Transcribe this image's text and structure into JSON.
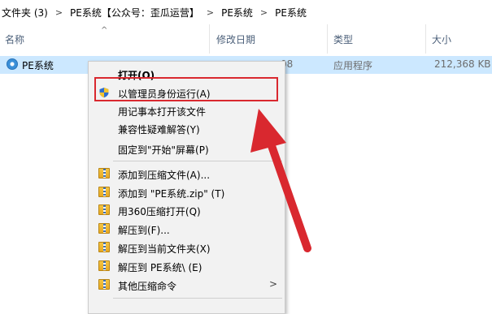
{
  "breadcrumb": {
    "items": [
      "文件夹 (3)",
      "PE系统【公众号：歪瓜运营】",
      "PE系统",
      "PE系统"
    ]
  },
  "columns": {
    "name": "名称",
    "date": "修改日期",
    "type": "类型",
    "size": "大小"
  },
  "file": {
    "name": "PE系统",
    "date_partial": ":08",
    "type": "应用程序",
    "size": "212,368 KB"
  },
  "context_menu": {
    "items": [
      {
        "label": "打开(O)",
        "icon": "none",
        "bold": true
      },
      {
        "label": "以管理员身份运行(A)",
        "icon": "uac-shield-icon"
      },
      {
        "label": "用记事本打开该文件",
        "icon": "none"
      },
      {
        "label": "兼容性疑难解答(Y)",
        "icon": "none"
      },
      {
        "label": "固定到\"开始\"屏幕(P)",
        "icon": "none"
      },
      {
        "label": "添加到压缩文件(A)...",
        "icon": "zip-icon"
      },
      {
        "label": "添加到 \"PE系统.zip\" (T)",
        "icon": "zip-icon"
      },
      {
        "label": "用360压缩打开(Q)",
        "icon": "zip-icon"
      },
      {
        "label": "解压到(F)...",
        "icon": "zip-icon"
      },
      {
        "label": "解压到当前文件夹(X)",
        "icon": "zip-icon"
      },
      {
        "label": "解压到 PE系统\\ (E)",
        "icon": "zip-icon"
      },
      {
        "label": "其他压缩命令",
        "icon": "zip-icon",
        "submenu": true
      }
    ]
  },
  "colors": {
    "selection": "#cce8ff",
    "menu_bg": "#f2f2f2",
    "annotation_red": "#d9282f"
  }
}
